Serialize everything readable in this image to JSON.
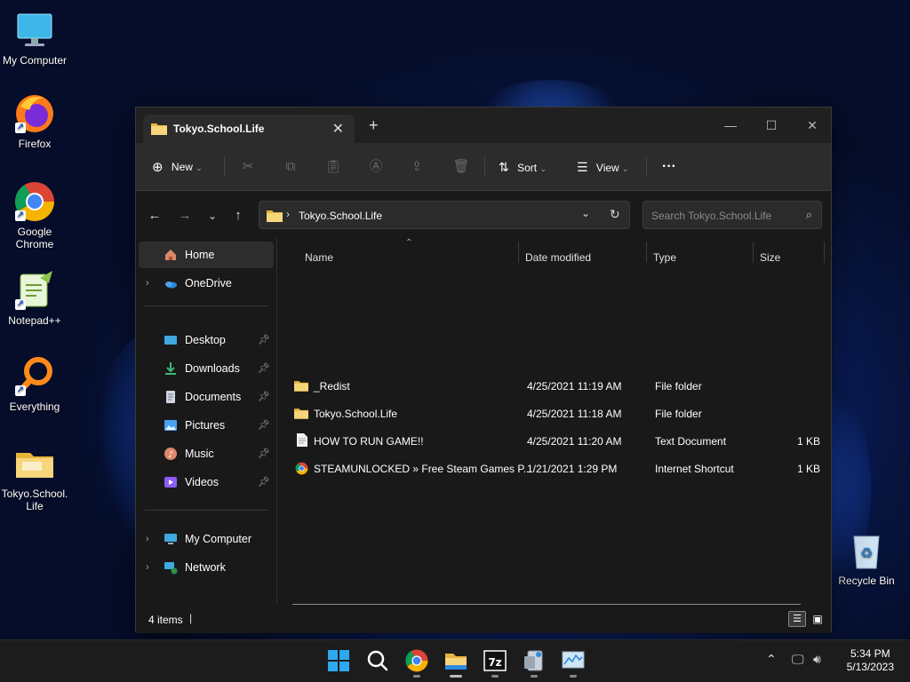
{
  "desktop": {
    "icons": [
      {
        "label": "My Computer"
      },
      {
        "label": "Firefox"
      },
      {
        "label": "Google Chrome"
      },
      {
        "label": "Notepad++"
      },
      {
        "label": "Everything"
      },
      {
        "label": "Tokyo.School. Life"
      },
      {
        "label": "Recycle Bin"
      }
    ]
  },
  "window": {
    "tab_title": "Tokyo.School.Life",
    "toolbar": {
      "new_label": "New",
      "sort_label": "Sort",
      "view_label": "View"
    },
    "address": {
      "path": "Tokyo.School.Life"
    },
    "search": {
      "placeholder": "Search Tokyo.School.Life"
    },
    "nav": {
      "home": "Home",
      "onedrive": "OneDrive",
      "quick": [
        "Desktop",
        "Downloads",
        "Documents",
        "Pictures",
        "Music",
        "Videos"
      ],
      "my_computer": "My Computer",
      "network": "Network"
    },
    "columns": {
      "name": "Name",
      "date": "Date modified",
      "type": "Type",
      "size": "Size"
    },
    "files": [
      {
        "name": "_Redist",
        "date": "4/25/2021 11:19 AM",
        "type": "File folder",
        "size": "",
        "icon": "folder-icon"
      },
      {
        "name": "Tokyo.School.Life",
        "date": "4/25/2021 11:18 AM",
        "type": "File folder",
        "size": "",
        "icon": "folder-icon"
      },
      {
        "name": "HOW TO RUN GAME!!",
        "date": "4/25/2021 11:20 AM",
        "type": "Text Document",
        "size": "1 KB",
        "icon": "text-document-icon"
      },
      {
        "name": "STEAMUNLOCKED » Free Steam Games P...",
        "date": "1/21/2021 1:29 PM",
        "type": "Internet Shortcut",
        "size": "1 KB",
        "icon": "chrome-shortcut-icon"
      }
    ],
    "status": {
      "items": "4 items"
    }
  },
  "taskbar": {
    "time": "5:34 PM",
    "date": "5/13/2023"
  },
  "colors": {
    "folder": "#f2c14e",
    "accent": "#1a73e8",
    "window_bg": "#191919"
  }
}
